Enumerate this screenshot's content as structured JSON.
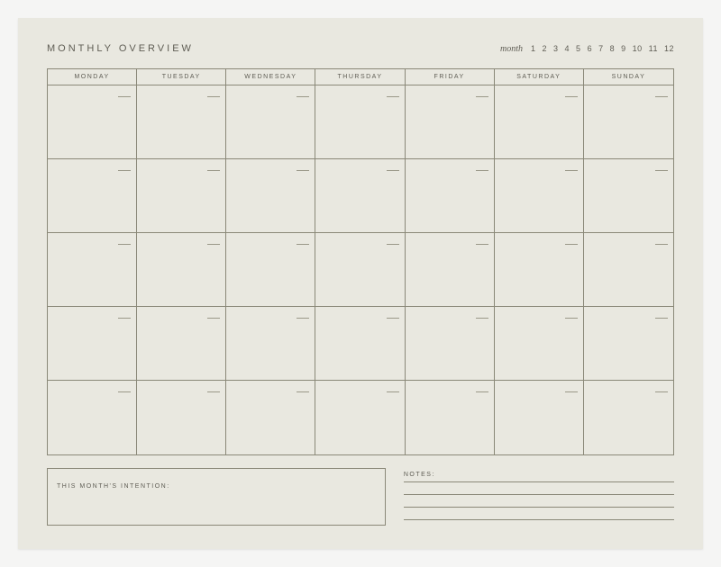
{
  "header": {
    "title": "MONTHLY OVERVIEW",
    "month_label": "month",
    "months": [
      "1",
      "2",
      "3",
      "4",
      "5",
      "6",
      "7",
      "8",
      "9",
      "10",
      "11",
      "12"
    ]
  },
  "days": [
    "MONDAY",
    "TUESDAY",
    "WEDNESDAY",
    "THURSDAY",
    "FRIDAY",
    "SATURDAY",
    "SUNDAY"
  ],
  "footer": {
    "intention_label": "THIS MONTH'S INTENTION:",
    "notes_label": "NOTES:"
  }
}
